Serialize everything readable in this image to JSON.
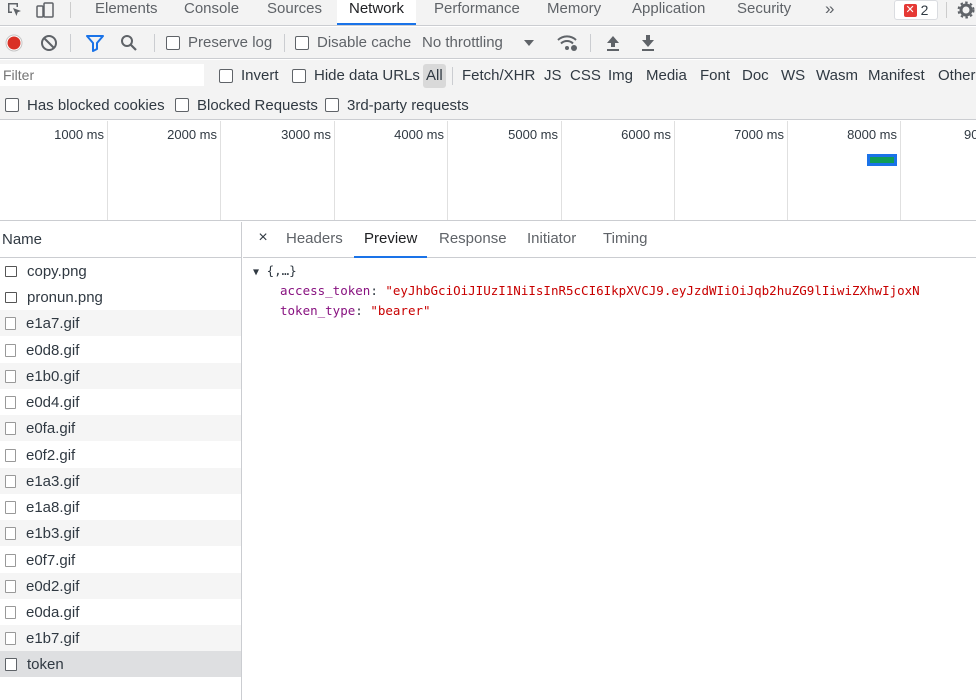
{
  "devtools": {
    "tabs": [
      "Elements",
      "Console",
      "Sources",
      "Network",
      "Performance",
      "Memory",
      "Application",
      "Security"
    ],
    "active_tab": "Network",
    "more_tabs_glyph": "»",
    "error_count": "2",
    "icons": {
      "inspect": "inspect-element-icon",
      "device": "device-toolbar-icon",
      "settings": "gear-icon"
    }
  },
  "toolbar": {
    "preserve_log": "Preserve log",
    "disable_cache": "Disable cache",
    "throttling": "No throttling",
    "icons": [
      "record-icon",
      "clear-icon",
      "filter-icon",
      "search-icon",
      "network-conditions-icon",
      "import-har-icon",
      "export-har-icon"
    ]
  },
  "filter": {
    "placeholder": "Filter",
    "invert": "Invert",
    "hide_data_urls": "Hide data URLs",
    "types": [
      "All",
      "Fetch/XHR",
      "JS",
      "CSS",
      "Img",
      "Media",
      "Font",
      "Doc",
      "WS",
      "Wasm",
      "Manifest",
      "Other"
    ],
    "active_type": "All",
    "has_blocked_cookies": "Has blocked cookies",
    "blocked_requests": "Blocked Requests",
    "third_party": "3rd-party requests"
  },
  "overview": {
    "labels": [
      "1000 ms",
      "2000 ms",
      "3000 ms",
      "4000 ms",
      "5000 ms",
      "6000 ms",
      "7000 ms",
      "8000 ms",
      "90"
    ],
    "colors": {
      "request_bar": "#1a73e8",
      "request_fill": "#0f9d58"
    }
  },
  "requests": {
    "header": "Name",
    "items": [
      "copy.png",
      "pronun.png",
      "e1a7.gif",
      "e0d8.gif",
      "e1b0.gif",
      "e0d4.gif",
      "e0fa.gif",
      "e0f2.gif",
      "e1a3.gif",
      "e1a8.gif",
      "e1b3.gif",
      "e0f7.gif",
      "e0d2.gif",
      "e0da.gif",
      "e1b7.gif",
      "token"
    ],
    "selected": "token"
  },
  "detail": {
    "tabs": [
      "Headers",
      "Preview",
      "Response",
      "Initiator",
      "Timing"
    ],
    "active_tab": "Preview",
    "close_glyph": "×",
    "preview": {
      "summary": "{,…}",
      "access_token_key": "access_token",
      "access_token_value": "\"eyJhbGciOiJIUzI1NiIsInR5cCI6IkpXVCJ9.eyJzdWIiOiJqb2huZG9lIiwiZXhwIjoxN",
      "token_type_key": "token_type",
      "token_type_value": "\"bearer\""
    }
  }
}
